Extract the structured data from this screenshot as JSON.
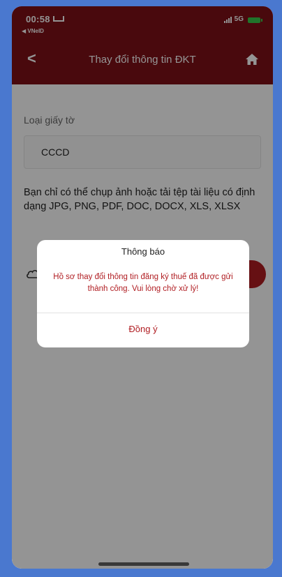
{
  "status_bar": {
    "time": "00:58",
    "back_app": "◀ VNeID",
    "network": "5G"
  },
  "nav": {
    "back_icon": "chevron-left-icon",
    "title": "Thay đổi thông tin ĐKT",
    "home_icon": "home-icon"
  },
  "form": {
    "doc_type_label": "Loại giấy tờ",
    "doc_type_value": "CCCD",
    "hint": "Bạn chỉ có thể chụp ảnh hoặc tải tệp tài liệu có định dạng JPG, PNG, PDF, DOC, DOCX, XLS, XLSX"
  },
  "dialog": {
    "title": "Thông báo",
    "message": "Hồ sơ thay đổi thông tin đăng ký thuế đã được gửi thành công. Vui lòng chờ xử lý!",
    "ok_label": "Đồng ý"
  },
  "colors": {
    "header": "#7e1017",
    "accent": "#b01d22",
    "frame": "#4a78cf"
  }
}
